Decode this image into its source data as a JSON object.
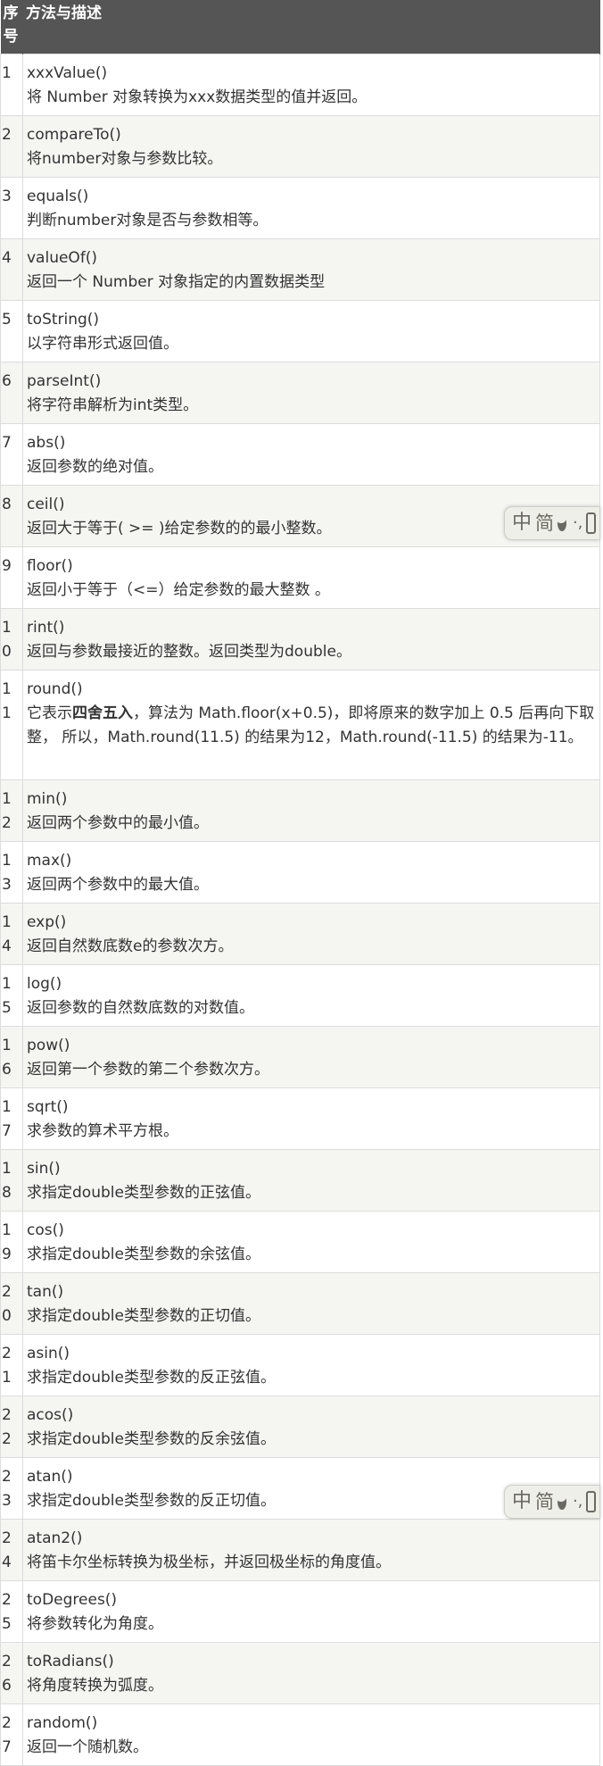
{
  "table": {
    "header": {
      "index": "序号",
      "method": "方法与描述"
    },
    "rows": [
      {
        "index": "1",
        "name": "xxxValue()",
        "desc": "将 Number 对象转换为xxx数据类型的值并返回。"
      },
      {
        "index": "2",
        "name": "compareTo()",
        "desc": "将number对象与参数比较。"
      },
      {
        "index": "3",
        "name": "equals()",
        "desc": "判断number对象是否与参数相等。"
      },
      {
        "index": "4",
        "name": "valueOf()",
        "desc": "返回一个 Number 对象指定的内置数据类型"
      },
      {
        "index": "5",
        "name": "toString()",
        "desc": "以字符串形式返回值。"
      },
      {
        "index": "6",
        "name": "parseInt()",
        "desc": "将字符串解析为int类型。"
      },
      {
        "index": "7",
        "name": "abs()",
        "desc": "返回参数的绝对值。"
      },
      {
        "index": "8",
        "name": "ceil()",
        "desc": "返回大于等于( >= )给定参数的的最小整数。"
      },
      {
        "index": "9",
        "name": "floor()",
        "desc": "返回小于等于（<=）给定参数的最大整数 。"
      },
      {
        "index": "10",
        "name": "rint()",
        "desc": "返回与参数最接近的整数。返回类型为double。"
      },
      {
        "index": "11",
        "name": "round()",
        "desc_pre": "它表示",
        "desc_bold": "四舍五入",
        "desc_post": "，算法为 Math.floor(x+0.5)，即将原来的数字加上 0.5 后再向下取整， 所以，Math.round(11.5) 的结果为12，Math.round(-11.5) 的结果为-11。"
      },
      {
        "index": "12",
        "name": "min()",
        "desc": "返回两个参数中的最小值。"
      },
      {
        "index": "13",
        "name": "max()",
        "desc": "返回两个参数中的最大值。"
      },
      {
        "index": "14",
        "name": "exp()",
        "desc": "返回自然数底数e的参数次方。"
      },
      {
        "index": "15",
        "name": "log()",
        "desc": "返回参数的自然数底数的对数值。"
      },
      {
        "index": "16",
        "name": "pow()",
        "desc": "返回第一个参数的第二个参数次方。"
      },
      {
        "index": "17",
        "name": "sqrt()",
        "desc": "求参数的算术平方根。"
      },
      {
        "index": "18",
        "name": "sin()",
        "desc": "求指定double类型参数的正弦值。"
      },
      {
        "index": "19",
        "name": "cos()",
        "desc": "求指定double类型参数的余弦值。"
      },
      {
        "index": "20",
        "name": "tan()",
        "desc": "求指定double类型参数的正切值。"
      },
      {
        "index": "21",
        "name": "asin()",
        "desc": "求指定double类型参数的反正弦值。"
      },
      {
        "index": "22",
        "name": "acos()",
        "desc": "求指定double类型参数的反余弦值。"
      },
      {
        "index": "23",
        "name": "atan()",
        "desc": "求指定double类型参数的反正切值。"
      },
      {
        "index": "24",
        "name": "atan2()",
        "desc": "将笛卡尔坐标转换为极坐标，并返回极坐标的角度值。"
      },
      {
        "index": "25",
        "name": "toDegrees()",
        "desc": "将参数转化为角度。"
      },
      {
        "index": "26",
        "name": "toRadians()",
        "desc": "将角度转换为弧度。"
      },
      {
        "index": "27",
        "name": "random()",
        "desc": "返回一个随机数。"
      }
    ]
  },
  "ime_toolbar": {
    "logo_glyph": "中",
    "mode_label": "简",
    "icons": [
      "moon-icon",
      "punctuation-icon",
      "more-icon"
    ],
    "text_color": "#6a6a62",
    "background": "#efefe9"
  },
  "colors": {
    "header_bg": "#555555",
    "header_text": "#ffffff",
    "row_alt_bg": "#f5f5f2",
    "border": "#dddddd",
    "body_text": "#333333"
  }
}
